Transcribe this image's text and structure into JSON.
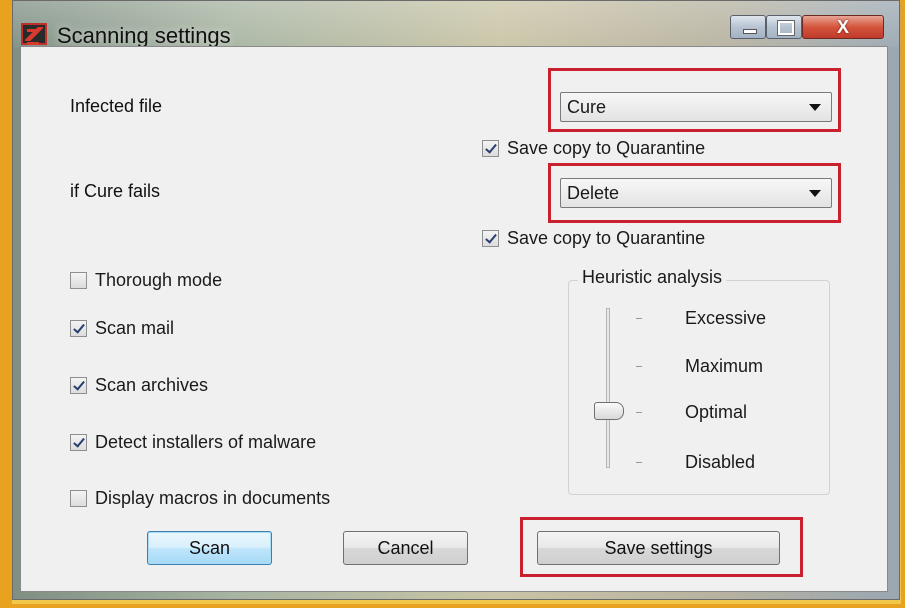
{
  "window": {
    "title": "Scanning settings",
    "close_glyph": "X",
    "icons": [
      "app-icon",
      "minimize-icon",
      "maximize-icon",
      "close-icon"
    ]
  },
  "infected": {
    "label": "Infected file",
    "action": "Cure",
    "quarantine_label": "Save copy to Quarantine",
    "quarantine_checked": true
  },
  "cure_fails": {
    "label": "if Cure fails",
    "action": "Delete",
    "quarantine_label": "Save copy to Quarantine",
    "quarantine_checked": true
  },
  "options": [
    {
      "label": "Thorough mode",
      "checked": false
    },
    {
      "label": "Scan mail",
      "checked": true
    },
    {
      "label": "Scan archives",
      "checked": true
    },
    {
      "label": "Detect installers of malware",
      "checked": true
    },
    {
      "label": "Display macros in documents",
      "checked": false
    }
  ],
  "heuristic": {
    "title": "Heuristic analysis",
    "levels": [
      "Excessive",
      "Maximum",
      "Optimal",
      "Disabled"
    ],
    "selected": "Optimal"
  },
  "buttons": {
    "scan": "Scan",
    "cancel": "Cancel",
    "save": "Save settings"
  },
  "colors": {
    "highlight": "#c8202c",
    "default_button": "#bee6fd",
    "outer_frame": "#e9a21f"
  }
}
